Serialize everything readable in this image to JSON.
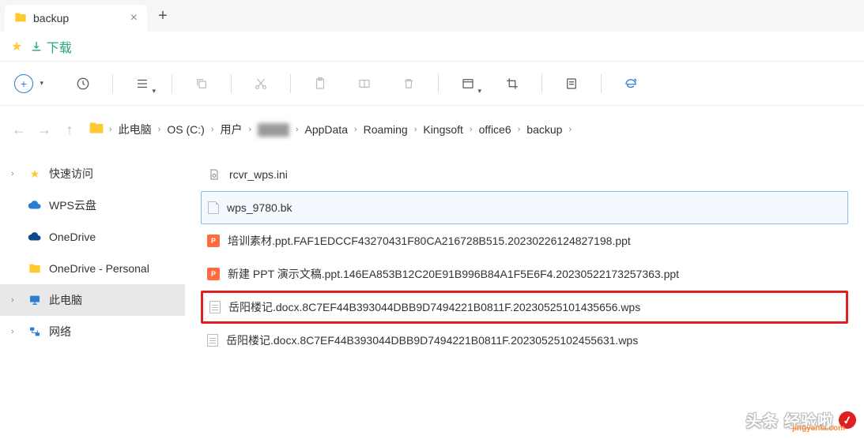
{
  "tab": {
    "title": "backup"
  },
  "bookmarks": {
    "download": "下载"
  },
  "breadcrumb": {
    "items": [
      "此电脑",
      "OS (C:)",
      "用户",
      "",
      "AppData",
      "Roaming",
      "Kingsoft",
      "office6",
      "backup"
    ]
  },
  "sidebar": {
    "items": [
      {
        "label": "快速访问",
        "icon": "star"
      },
      {
        "label": "WPS云盘",
        "icon": "cloud-blue"
      },
      {
        "label": "OneDrive",
        "icon": "cloud-dark"
      },
      {
        "label": "OneDrive - Personal",
        "icon": "folder"
      },
      {
        "label": "此电脑",
        "icon": "monitor"
      },
      {
        "label": "网络",
        "icon": "network"
      }
    ]
  },
  "files": {
    "items": [
      {
        "name": "rcvr_wps.ini",
        "type": "ini"
      },
      {
        "name": "wps_9780.bk",
        "type": "bk"
      },
      {
        "name": "培训素材.ppt.FAF1EDCCF43270431F80CA216728B515.20230226124827198.ppt",
        "type": "ppt"
      },
      {
        "name": "新建 PPT 演示文稿.ppt.146EA853B12C20E91B996B84A1F5E6F4.20230522173257363.ppt",
        "type": "ppt"
      },
      {
        "name": "岳阳楼记.docx.8C7EF44B393044DBB9D7494221B0811F.20230525101435656.wps",
        "type": "doc"
      },
      {
        "name": "岳阳楼记.docx.8C7EF44B393044DBB9D7494221B0811F.20230525102455631.wps",
        "type": "doc"
      }
    ]
  },
  "watermark": {
    "main": "头条 经验啦",
    "sub": "jingyanla.com",
    "check": "✓"
  }
}
